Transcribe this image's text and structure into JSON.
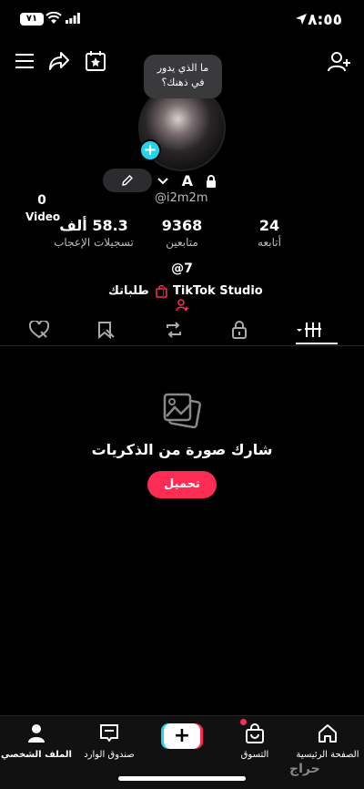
{
  "status_bar": {
    "time": "٨:٥٥",
    "battery": "٧١"
  },
  "profile": {
    "bubble_text_line1": "ما الذي يدور",
    "bubble_text_line2": "في ذهنك؟",
    "display_name": "A",
    "username": "@i2m2m",
    "video_count": "0",
    "video_label": "Video",
    "bio": "@7"
  },
  "stats": [
    {
      "num": "24",
      "label": "أتابعه"
    },
    {
      "num": "9368",
      "label": "متابعين"
    },
    {
      "num": "58.3 ألف",
      "label": "تسجيلات الإعجاب"
    }
  ],
  "links": {
    "studio": "TikTok Studio",
    "orders": "طلباتك"
  },
  "empty_state": {
    "title": "شارك صورة من الذكريات",
    "button": "تحميل"
  },
  "bottom_nav": {
    "home": "الصفحة الرئيسية",
    "shop": "التسوق",
    "create": "+",
    "inbox": "صندوق الوارد",
    "profile": "الملف الشخصي"
  },
  "watermark": "حراج",
  "colors": {
    "accent": "#fe2c55",
    "cyan": "#20d5ec",
    "background": "#000000"
  }
}
